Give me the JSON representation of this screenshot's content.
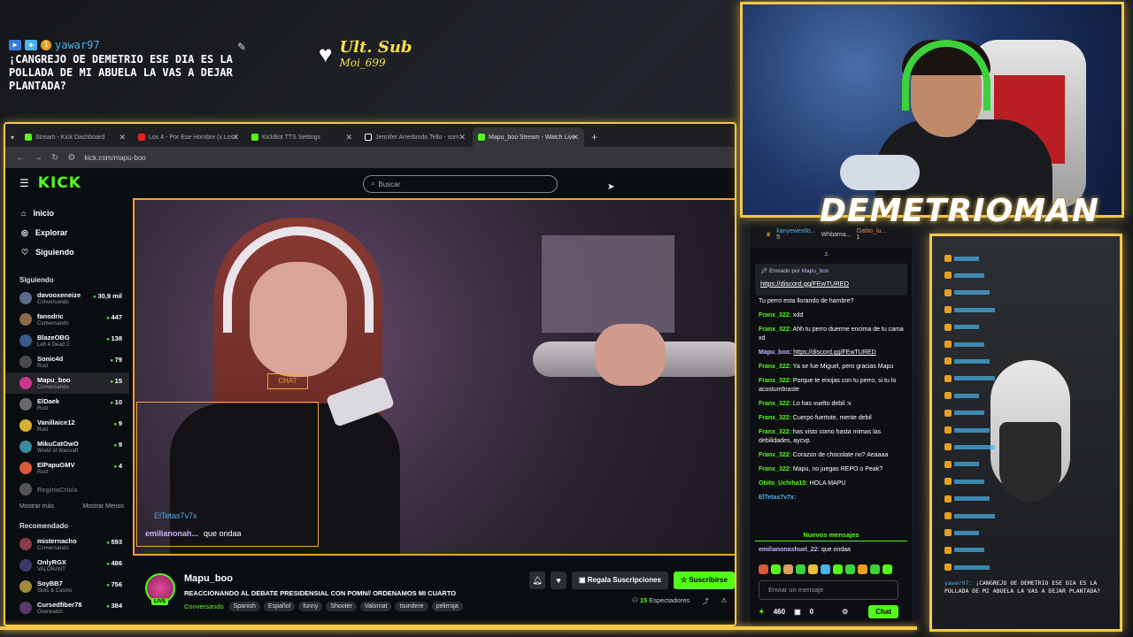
{
  "alert": {
    "user": "yawar97",
    "badge": "1",
    "message": "¡CANGREJO OE DEMETRIO ESE DIA ES LA POLLADA DE MI ABUELA LA VAS A DEJAR PLANTADA?"
  },
  "ult_sub": {
    "label": "Ult. Sub",
    "name": "Moi_699"
  },
  "browser": {
    "tabs": [
      {
        "label": "Stream - Kick Dashboard",
        "active": false
      },
      {
        "label": "Los 4 - Por Ese Hombre (x Los I",
        "active": false
      },
      {
        "label": "KickBot TTS Settings",
        "active": false
      },
      {
        "label": "Jennifer Arredondo Tello - som",
        "active": false
      },
      {
        "label": "Mapu_boo Stream - Watch Live",
        "active": true
      }
    ],
    "new_tab": "+",
    "url": "kick.com/mapu-boo"
  },
  "kick": {
    "logo": "KICK",
    "search_placeholder": "Buscar",
    "nav": [
      {
        "icon": "home-icon",
        "label": "Inicio"
      },
      {
        "icon": "compass-icon",
        "label": "Explorar"
      },
      {
        "icon": "heart-icon",
        "label": "Siguiendo"
      }
    ],
    "following_title": "Siguiendo",
    "following": [
      {
        "name": "davooxeneize",
        "sub": "Conversando",
        "viewers": "30,9 mil",
        "color": "#5a6b8a"
      },
      {
        "name": "fanodric",
        "sub": "Conversando",
        "viewers": "447",
        "color": "#8a6a4a"
      },
      {
        "name": "BlazeOBG",
        "sub": "Left 4 Dead 2",
        "viewers": "138",
        "color": "#3a5a8a"
      },
      {
        "name": "Sonic4d",
        "sub": "Rust",
        "viewers": "79",
        "color": "#4a4a4a"
      },
      {
        "name": "Mapu_boo",
        "sub": "Conversando",
        "viewers": "15",
        "color": "#c83a8a"
      },
      {
        "name": "ElDaek",
        "sub": "Rust",
        "viewers": "10",
        "color": "#6a6a6a"
      },
      {
        "name": "Vanillaice12",
        "sub": "Rust",
        "viewers": "9",
        "color": "#d8b030"
      },
      {
        "name": "MikuCatOwO",
        "sub": "World of Warcraft",
        "viewers": "9",
        "color": "#3a8aa0"
      },
      {
        "name": "ElPapuGMV",
        "sub": "Rust",
        "viewers": "4",
        "color": "#d85a3a"
      },
      {
        "name": "ReginaCrisis",
        "sub": "",
        "viewers": "",
        "color": "#555555"
      }
    ],
    "show_more": "Mostrar más",
    "show_less": "Mostrar Menos",
    "recommended_title": "Recomendado",
    "recommended": [
      {
        "name": "misternacho",
        "sub": "Conversando",
        "viewers": "593",
        "color": "#8a3a4a"
      },
      {
        "name": "OnlyRGX",
        "sub": "VALORANT",
        "viewers": "486",
        "color": "#3a3a6a"
      },
      {
        "name": "SoyBB7",
        "sub": "Slots & Casino",
        "viewers": "756",
        "color": "#a08a3a"
      },
      {
        "name": "Cursedfiber78",
        "sub": "Overwatch",
        "viewers": "384",
        "color": "#5a3a6a"
      }
    ],
    "player": {
      "overlay_chip": "CHAT",
      "overlay_user1": "ElTetas7v7x",
      "overlay_user2": "emilianonah...",
      "overlay_msg2": "que ondaa"
    },
    "channel": {
      "name": "Mapu_boo",
      "live": "LIVE",
      "title": "REACCIONANDO AL DEBATE PRESIDENSIAL CON POMN// ORDENAMOS MI CUARTO",
      "category": "Conversando",
      "tags": [
        "Spanish",
        "Español",
        "funny",
        "Shooter",
        "Valornat",
        "tsundere",
        "pelirroja"
      ],
      "gift_label": "Regala Suscripciones",
      "subscribe_label": "Suscribirse",
      "viewers_count": "15",
      "viewers_label": "Espectadores"
    }
  },
  "chat": {
    "top_users": [
      {
        "name": "kanyewestlo...",
        "count": "5"
      },
      {
        "name": "Whbama...",
        "count": ""
      },
      {
        "name": "Gatito_lu...",
        "count": "1"
      }
    ],
    "pinned_by_label": "Enviado por",
    "pinned_by": "Mapu_boo",
    "pinned_link": "https://discord.gg/FEwTURED",
    "messages": [
      {
        "user": "",
        "text": "Tu perro esta llorando de hambre?",
        "type": "g"
      },
      {
        "user": "Franx_322:",
        "text": "xdd",
        "type": "g"
      },
      {
        "user": "Franx_322:",
        "text": "Ahh tu perro duerme encima de tu cama xd",
        "type": "g"
      },
      {
        "user": "Mapu_boo:",
        "text": "https://discord.gg/FEwTURED",
        "type": "p"
      },
      {
        "user": "Franx_322:",
        "text": "Ya se fue Miguel, pero gracias Mapu",
        "type": "g"
      },
      {
        "user": "Franx_322:",
        "text": "Porque te enojas con tu perro, si tu lo acostumbraste",
        "type": "g"
      },
      {
        "user": "Franx_322:",
        "text": "Lo has vuelto debil :v",
        "type": "g"
      },
      {
        "user": "Franx_322:",
        "text": "Cuerpo fuertote, mente debil",
        "type": "g"
      },
      {
        "user": "Franx_322:",
        "text": "has visto como hasta mimas las debilidades, aycvp",
        "type": "g"
      },
      {
        "user": "Franx_322:",
        "text": "Corazon de chocolate no? Aeaaaa",
        "type": "g"
      },
      {
        "user": "Franx_322:",
        "text": "Mapu, no juegas REPO o Peak?",
        "type": "g"
      },
      {
        "user": "Obito_Uchiha10:",
        "text": "HOLA MAPU",
        "type": "g"
      },
      {
        "user": "ElTetas7v7x:",
        "text": "",
        "type": "b"
      }
    ],
    "new_messages": "Nuevos mensajes",
    "last_user": "emilianonashuel_22:",
    "last_text": "que ondaa",
    "input_placeholder": "Enviar un mensaje",
    "kicks": "460",
    "gifts": "0",
    "chat_button": "Chat"
  },
  "webcam": {
    "name": "DEMETRIOMAN"
  },
  "stream_chat": {
    "last_user": "yawar97:",
    "last_msg": "¡CANGREJO OE DEMETRIO ESE DIA ES LA POLLADA DE MI ABUELA LA VAS A DEJAR PLANTADA?"
  }
}
